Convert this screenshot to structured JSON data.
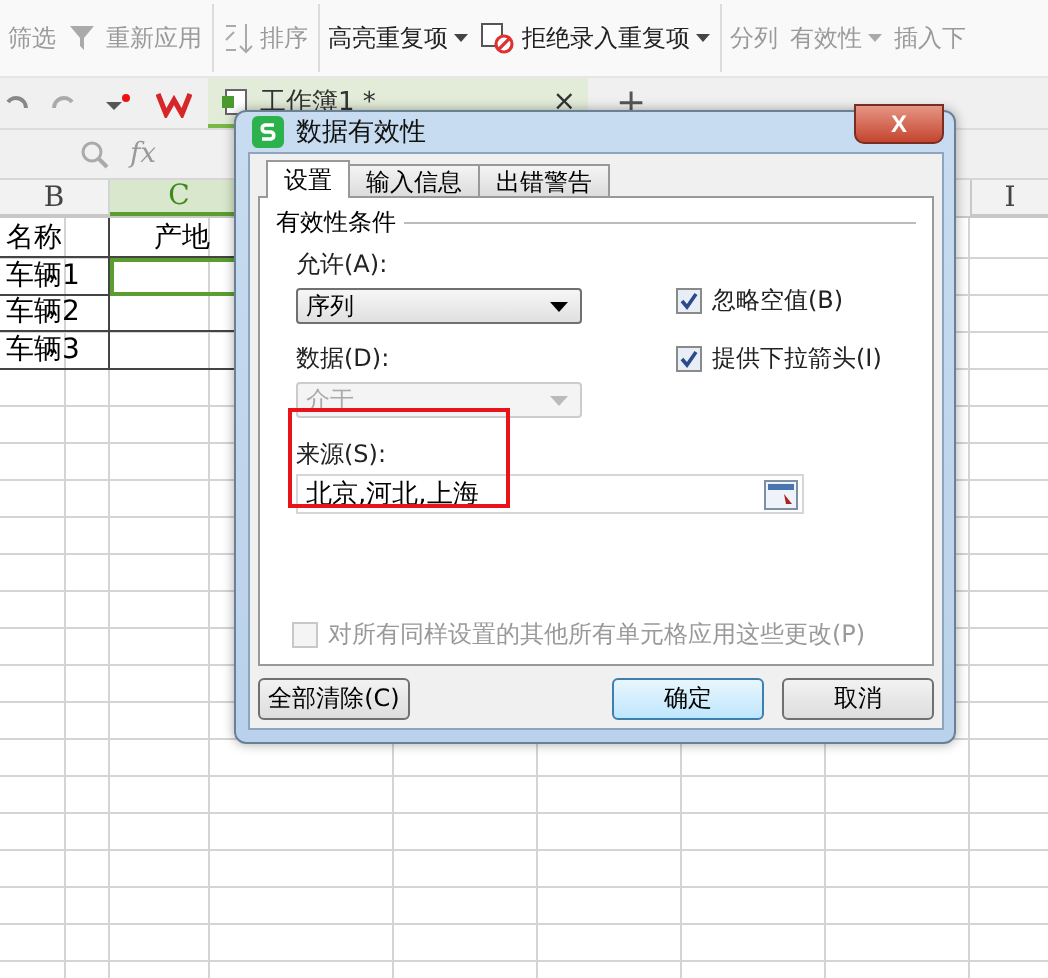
{
  "ribbon": {
    "groups": [
      {
        "items": [
          {
            "label": "筛选",
            "kind": "plain",
            "disabled": true
          },
          {
            "label": "重新应用",
            "kind": "funnel",
            "disabled": true
          }
        ]
      },
      {
        "items": [
          {
            "label": "排序",
            "kind": "sort",
            "disabled": true
          }
        ]
      },
      {
        "items": [
          {
            "label": "高亮重复项",
            "kind": "plain",
            "disabled": false,
            "dropdown": true
          },
          {
            "label": "拒绝录入重复项",
            "kind": "reject",
            "disabled": false,
            "dropdown": true
          }
        ]
      },
      {
        "items": [
          {
            "label": "分列",
            "kind": "plain",
            "disabled": true
          },
          {
            "label": "有效性",
            "kind": "plain",
            "disabled": true,
            "dropdown": true
          },
          {
            "label": "插入下",
            "kind": "plain",
            "disabled": true
          }
        ]
      }
    ]
  },
  "document_tab": {
    "title": "工作簿1 *",
    "close": "×",
    "new_tab": "+"
  },
  "formula_bar": {
    "function_label": "fx"
  },
  "sheet": {
    "columns": [
      {
        "header": "B",
        "selected": false
      },
      {
        "header": "C",
        "selected": true
      },
      {
        "header": "I",
        "selected": false
      }
    ],
    "rows": [
      {
        "name": "名称",
        "origin": "产地",
        "c_selected": false
      },
      {
        "name": "车辆1",
        "c_selected": true
      },
      {
        "name": "车辆2",
        "c_selected": false
      },
      {
        "name": "车辆3",
        "c_selected": false
      }
    ]
  },
  "dialog": {
    "title": "数据有效性",
    "close": "X",
    "tabs": [
      {
        "label": "设置",
        "selected": true
      },
      {
        "label": "输入信息",
        "selected": false
      },
      {
        "label": "出错警告",
        "selected": false
      }
    ],
    "group_title": "有效性条件",
    "allow": {
      "label": "允许(A):",
      "value": "序列",
      "disabled": false
    },
    "data": {
      "label": "数据(D):",
      "value": "介于",
      "disabled": true
    },
    "checkboxes": [
      {
        "label": "忽略空值(B)",
        "checked": true,
        "disabled": false
      },
      {
        "label": "提供下拉箭头(I)",
        "checked": true,
        "disabled": false
      }
    ],
    "source": {
      "label": "来源(S):",
      "value": "北京,河北,上海"
    },
    "apply_all": {
      "label": "对所有同样设置的其他所有单元格应用这些更改(P)",
      "checked": false,
      "disabled": true
    },
    "buttons": [
      {
        "label": "全部清除(C)",
        "kind": "left",
        "default": false
      },
      {
        "label": "确定",
        "kind": "right",
        "default": true
      },
      {
        "label": "取消",
        "kind": "right",
        "default": false
      }
    ]
  }
}
